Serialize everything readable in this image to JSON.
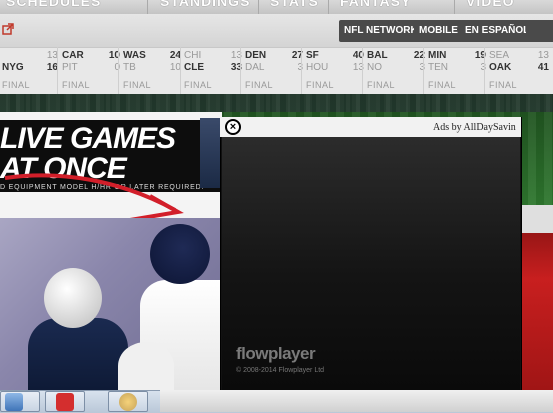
{
  "topnav": {
    "tabs": [
      "SCHEDULES",
      "STANDINGS",
      "STATS",
      "FANTASY",
      "VIDEO"
    ]
  },
  "subnav": {
    "external_link_icon": "external-link-icon",
    "pills": [
      "NFL NETWORK",
      "MOBILE",
      "EN ESPAÑOL"
    ]
  },
  "scores": {
    "games": [
      {
        "away": "",
        "away_score": "13",
        "home": "NYG",
        "home_score": "16",
        "status": "FINAL"
      },
      {
        "away": "CAR",
        "away_score": "10",
        "home": "PIT",
        "home_score": "0",
        "status": "FINAL"
      },
      {
        "away": "WAS",
        "away_score": "24",
        "home": "TB",
        "home_score": "10",
        "status": "FINAL"
      },
      {
        "away": "CHI",
        "away_score": "13",
        "home": "CLE",
        "home_score": "33",
        "status": "FINAL"
      },
      {
        "away": "DEN",
        "away_score": "27",
        "home": "DAL",
        "home_score": "3",
        "status": "FINAL"
      },
      {
        "away": "SF",
        "away_score": "40",
        "home": "HOU",
        "home_score": "13",
        "status": "FINAL"
      },
      {
        "away": "BAL",
        "away_score": "22",
        "home": "NO",
        "home_score": "3",
        "status": "FINAL"
      },
      {
        "away": "MIN",
        "away_score": "19",
        "home": "TEN",
        "home_score": "3",
        "status": "FINAL"
      },
      {
        "away": "SEA",
        "away_score": "13",
        "home": "OAK",
        "home_score": "41",
        "status": "FINAL"
      }
    ]
  },
  "ad": {
    "headline_1": "LIVE GAMES",
    "headline_2": "AT ONCE",
    "fine_print": "D EQUIPMENT MODEL H/HR OR LATER REQUIRED."
  },
  "overlay": {
    "ads_by": "Ads by AllDaySavin",
    "close_symbol": "×",
    "player_logo": "flowplayer",
    "copyright": "© 2008-2014 Flowplayer Ltd"
  },
  "colors": {
    "pill_bg": "#4a4a4a",
    "field": "#2f7a2f",
    "overlay_bg": "#111111"
  }
}
